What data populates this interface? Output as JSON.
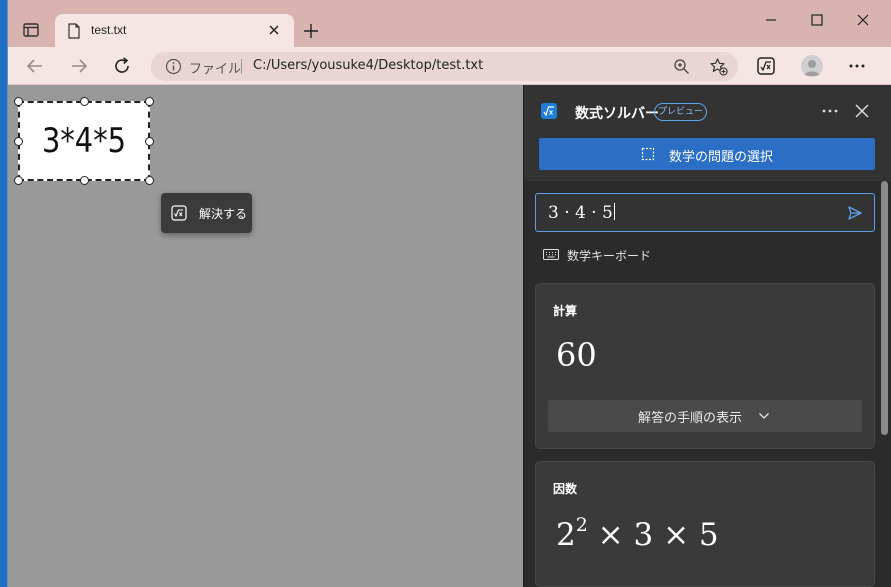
{
  "browser": {
    "tab": {
      "title": "test.txt"
    },
    "address": {
      "label": "ファイル",
      "url": "C:/Users/yousuke4/Desktop/test.txt"
    }
  },
  "content": {
    "selection_text": "3*4*5",
    "solve_popup_label": "解決する"
  },
  "panel": {
    "title": "数式ソルバー",
    "badge": "プレビュー",
    "select_button_label": "数学の問題の選択",
    "input_value": "3 · 4 · 5",
    "keyboard_label": "数学キーボード",
    "calc_card": {
      "title": "計算",
      "result": "60",
      "steps_button_label": "解答の手順の表示"
    },
    "factor_card": {
      "title": "因数",
      "base": "2",
      "exponent": "2",
      "rest": " × 3 × 5"
    },
    "colors": {
      "accent": "#2a6ec6",
      "panel_bg": "#2b2b2b",
      "tabstrip": "#d9b3b0"
    }
  }
}
